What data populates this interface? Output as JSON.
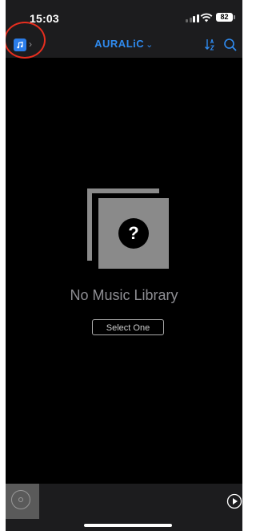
{
  "status_bar": {
    "time": "15:03",
    "battery": "82"
  },
  "nav": {
    "title": "AURALiC",
    "title_chevron": "⌄",
    "library_chevron": "›",
    "icons": [
      "music-library-icon",
      "chevron-right-icon",
      "chevron-down-icon",
      "sort-icon",
      "search-icon"
    ]
  },
  "empty_state": {
    "placeholder_mark": "?",
    "title": "No Music Library",
    "button": "Select One"
  },
  "mini_player": {
    "icons": [
      "album-art-placeholder-icon",
      "play-icon"
    ]
  },
  "colors": {
    "accent": "#2f8bf0",
    "highlight_ring": "#e62e1f",
    "background": "#000000",
    "bar_background": "#1c1c1e",
    "placeholder_gray": "#8a8a8a"
  }
}
